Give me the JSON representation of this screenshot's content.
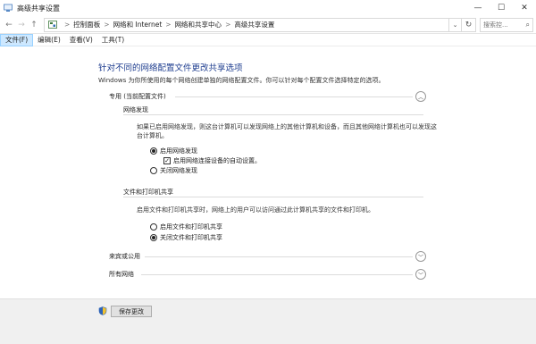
{
  "window": {
    "title": "高级共享设置",
    "controls": {
      "minimize": "—",
      "maximize": "☐",
      "close": "✕"
    }
  },
  "address": {
    "back": "←",
    "forward": "→",
    "up": "↑",
    "crumbs": [
      "控制面板",
      "网络和 Internet",
      "网络和共享中心",
      "高级共享设置"
    ],
    "separator": ">",
    "refresh": "↻",
    "dropdown": "⌄",
    "search_placeholder": "搜索控..."
  },
  "menu": {
    "file": "文件(F)",
    "edit": "编辑(E)",
    "view": "查看(V)",
    "tools": "工具(T)"
  },
  "main": {
    "heading": "针对不同的网络配置文件更改共享选项",
    "intro": "Windows 为你所使用的每个网络创建单独的网络配置文件。你可以针对每个配置文件选择特定的选项。",
    "private_profile": {
      "label": "专用 (当前配置文件)",
      "discovery": {
        "title": "网络发现",
        "desc": "如果已启用网络发现，则这台计算机可以发现网络上的其他计算机和设备，而且其他网络计算机也可以发现这台计算机。",
        "opt_on": "启用网络发现",
        "auto_setup": "启用网络连接设备的自动设置。",
        "opt_off": "关闭网络发现"
      },
      "sharing": {
        "title": "文件和打印机共享",
        "desc": "启用文件和打印机共享时，网络上的用户可以访问通过此计算机共享的文件和打印机。",
        "opt_on": "启用文件和打印机共享",
        "opt_off": "关闭文件和打印机共享"
      }
    },
    "guest_profile": {
      "label": "来宾或公用"
    },
    "all_networks": {
      "label": "所有网络"
    }
  },
  "footer": {
    "save": "保存更改"
  }
}
